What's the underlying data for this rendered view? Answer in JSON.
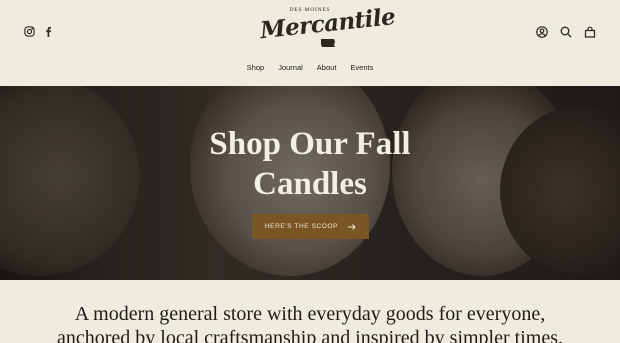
{
  "header": {
    "logo": {
      "top_text": "DES MOINES",
      "script_text": "Mercantile"
    },
    "social": [
      {
        "icon": "instagram-icon"
      },
      {
        "icon": "facebook-icon"
      }
    ],
    "utilities": [
      {
        "icon": "account-icon"
      },
      {
        "icon": "search-icon"
      },
      {
        "icon": "cart-icon"
      }
    ]
  },
  "nav": {
    "items": [
      "Shop",
      "Journal",
      "About",
      "Events"
    ]
  },
  "hero": {
    "title_line1": "Shop Our Fall",
    "title_line2": "Candles",
    "button_label": "HERE'S THE SCOOP",
    "button_icon": "arrow-right-icon",
    "button_color": "#7a5526"
  },
  "tagline": {
    "line1": "A modern general store with everyday goods for everyone,",
    "line2": "anchored by local craftsmanship and inspired by simpler times."
  }
}
